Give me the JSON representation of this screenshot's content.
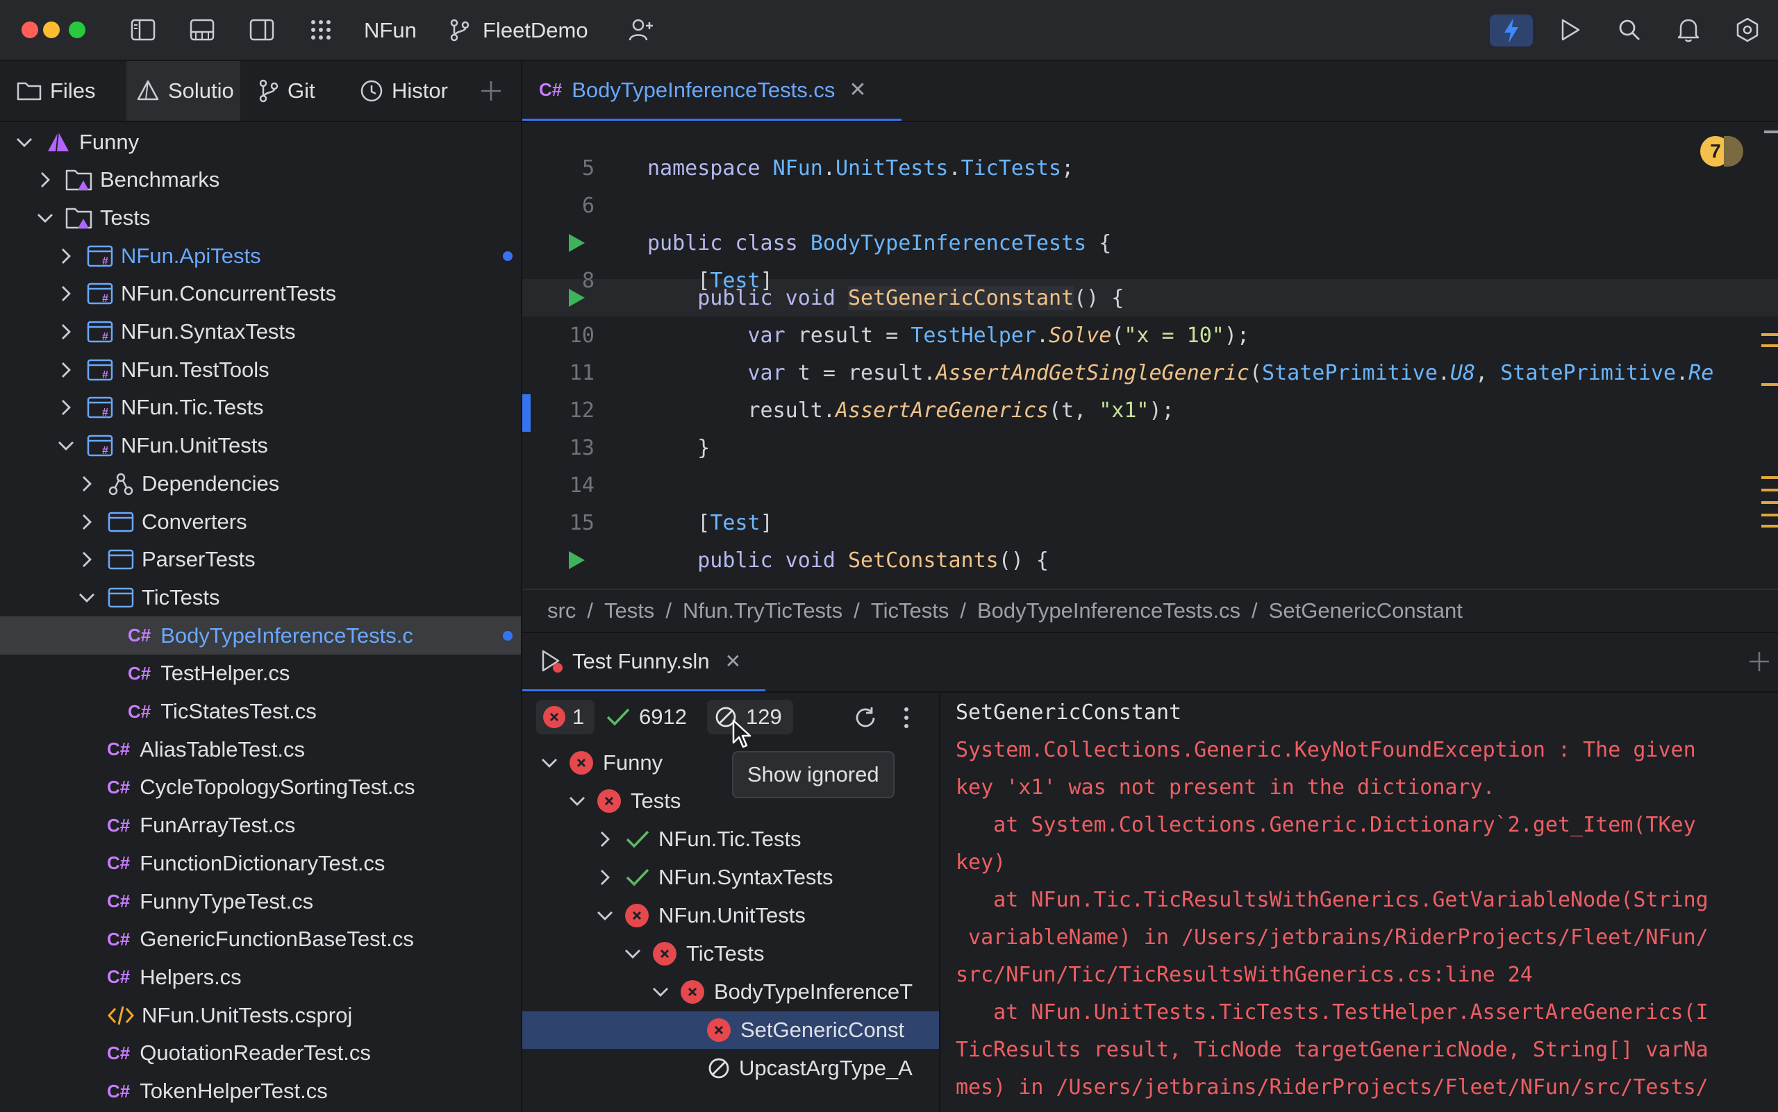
{
  "titlebar": {
    "app_name": "NFun",
    "workspace": "FleetDemo"
  },
  "left_tabs": [
    "Files",
    "Solutio",
    "Git",
    "Histor"
  ],
  "tree": [
    {
      "label": "Funny",
      "level": 0,
      "chevron": "down",
      "icon": "solution-icon",
      "style": "normal"
    },
    {
      "label": "Benchmarks",
      "level": 1,
      "chevron": "right",
      "icon": "folder-icon",
      "style": "normal"
    },
    {
      "label": "Tests",
      "level": 1,
      "chevron": "down",
      "icon": "folder-icon",
      "style": "normal"
    },
    {
      "label": "NFun.ApiTests",
      "level": 2,
      "chevron": "right",
      "icon": "csproj-icon",
      "style": "modified"
    },
    {
      "label": "NFun.ConcurrentTests",
      "level": 2,
      "chevron": "right",
      "icon": "csproj-icon",
      "style": "normal"
    },
    {
      "label": "NFun.SyntaxTests",
      "level": 2,
      "chevron": "right",
      "icon": "csproj-icon",
      "style": "normal"
    },
    {
      "label": "NFun.TestTools",
      "level": 2,
      "chevron": "right",
      "icon": "csproj-icon",
      "style": "normal"
    },
    {
      "label": "NFun.Tic.Tests",
      "level": 2,
      "chevron": "right",
      "icon": "csproj-icon",
      "style": "normal"
    },
    {
      "label": "NFun.UnitTests",
      "level": 2,
      "chevron": "down",
      "icon": "csproj-icon",
      "style": "normal"
    },
    {
      "label": "Dependencies",
      "level": 3,
      "chevron": "right",
      "icon": "dependencies-icon",
      "style": "normal"
    },
    {
      "label": "Converters",
      "level": 3,
      "chevron": "right",
      "icon": "namespace-folder-icon",
      "style": "normal"
    },
    {
      "label": "ParserTests",
      "level": 3,
      "chevron": "right",
      "icon": "namespace-folder-icon",
      "style": "normal"
    },
    {
      "label": "TicTests",
      "level": 3,
      "chevron": "down",
      "icon": "namespace-folder-icon",
      "style": "normal"
    },
    {
      "label": "BodyTypeInferenceTests.c",
      "level": 4,
      "chevron": "none",
      "icon": "csharp-file-icon",
      "style": "selected"
    },
    {
      "label": "TestHelper.cs",
      "level": 4,
      "chevron": "none",
      "icon": "csharp-file-icon",
      "style": "normal"
    },
    {
      "label": "TicStatesTest.cs",
      "level": 4,
      "chevron": "none",
      "icon": "csharp-file-icon",
      "style": "normal"
    },
    {
      "label": "AliasTableTest.cs",
      "level": 3,
      "chevron": "none",
      "icon": "csharp-file-icon",
      "style": "normal"
    },
    {
      "label": "CycleTopologySortingTest.cs",
      "level": 3,
      "chevron": "none",
      "icon": "csharp-file-icon",
      "style": "normal"
    },
    {
      "label": "FunArrayTest.cs",
      "level": 3,
      "chevron": "none",
      "icon": "csharp-file-icon",
      "style": "normal"
    },
    {
      "label": "FunctionDictionaryTest.cs",
      "level": 3,
      "chevron": "none",
      "icon": "csharp-file-icon",
      "style": "normal"
    },
    {
      "label": "FunnyTypeTest.cs",
      "level": 3,
      "chevron": "none",
      "icon": "csharp-file-icon",
      "style": "normal"
    },
    {
      "label": "GenericFunctionBaseTest.cs",
      "level": 3,
      "chevron": "none",
      "icon": "csharp-file-icon",
      "style": "normal"
    },
    {
      "label": "Helpers.cs",
      "level": 3,
      "chevron": "none",
      "icon": "csharp-file-icon",
      "style": "normal"
    },
    {
      "label": "NFun.UnitTests.csproj",
      "level": 3,
      "chevron": "none",
      "icon": "xml-file-icon",
      "style": "normal"
    },
    {
      "label": "QuotationReaderTest.cs",
      "level": 3,
      "chevron": "none",
      "icon": "csharp-file-icon",
      "style": "normal"
    },
    {
      "label": "TokenHelperTest.cs",
      "level": 3,
      "chevron": "none",
      "icon": "csharp-file-icon",
      "style": "normal"
    }
  ],
  "editor": {
    "tab_prefix": "C#",
    "tab_label": "BodyTypeInferenceTests.cs",
    "inspection_count": "7",
    "line_numbers": [
      "5",
      "6",
      "",
      "8",
      "",
      "10",
      "11",
      "12",
      "13",
      "14",
      "15",
      ""
    ],
    "code": {
      "l5_kw": "namespace ",
      "l5_ns1": "NFun",
      "l5_dot1": ".",
      "l5_ns2": "UnitTests",
      "l5_dot2": ".",
      "l5_ns3": "TicTests",
      "l5_end": ";",
      "l7_kw": "public class ",
      "l7_name": "BodyTypeInferenceTests",
      "l7_end": " {",
      "l8_open": "    [",
      "l8_attr": "Test",
      "l8_close": "]",
      "l9_kw": "    public void ",
      "l9_name": "SetGenericConstant",
      "l9_end": "() {",
      "l10_kw": "        var ",
      "l10_a": "result = ",
      "l10_ty": "TestHelper",
      "l10_dot": ".",
      "l10_fn": "Solve",
      "l10_p1": "(",
      "l10_str": "\"x = 10\"",
      "l10_p2": ");",
      "l11_kw": "        var ",
      "l11_a": "t = result.",
      "l11_fn": "AssertAndGetSingleGeneric",
      "l11_p1": "(",
      "l11_ty1": "StatePrimitive",
      "l11_dot1": ".",
      "l11_c1": "U8",
      "l11_comma": ", ",
      "l11_ty2": "StatePrimitive",
      "l11_dot2": ".",
      "l11_c2": "Re",
      "l12_a": "        result.",
      "l12_fn": "AssertAreGenerics",
      "l12_p1": "(t, ",
      "l12_str": "\"x1\"",
      "l12_p2": ");",
      "l13": "    }",
      "l15_open": "    [",
      "l15_attr": "Test",
      "l15_close": "]",
      "l16_kw": "    public void ",
      "l16_name": "SetConstants",
      "l16_end": "() {"
    }
  },
  "breadcrumb": [
    "src",
    "Tests",
    "Nfun.TryTicTests",
    "TicTests",
    "BodyTypeInferenceTests.cs",
    "SetGenericConstant"
  ],
  "test_panel": {
    "tab_label": "Test Funny.sln",
    "failed_count": "1",
    "passed_count": "6912",
    "ignored_count": "129",
    "tooltip": "Show ignored",
    "tree": [
      {
        "label": "Funny",
        "status": "failed",
        "chevron": "down",
        "level": 0
      },
      {
        "label": "Tests",
        "status": "failed",
        "chevron": "down",
        "level": 1
      },
      {
        "label": "NFun.Tic.Tests",
        "status": "passed",
        "chevron": "right",
        "level": 2
      },
      {
        "label": "NFun.SyntaxTests",
        "status": "passed",
        "chevron": "right",
        "level": 2
      },
      {
        "label": "NFun.UnitTests",
        "status": "failed",
        "chevron": "down",
        "level": 2
      },
      {
        "label": "TicTests",
        "status": "failed",
        "chevron": "down",
        "level": 3
      },
      {
        "label": "BodyTypeInferenceT",
        "status": "failed",
        "chevron": "down",
        "level": 4
      },
      {
        "label": "SetGenericConst",
        "status": "failed",
        "chevron": "none",
        "level": 5
      },
      {
        "label": "UpcastArgType_A",
        "status": "ignored",
        "chevron": "none",
        "level": 5
      }
    ],
    "output_title": "SetGenericConstant",
    "output_lines": [
      "System.Collections.Generic.KeyNotFoundException : The given",
      "key 'x1' was not present in the dictionary.",
      "   at System.Collections.Generic.Dictionary`2.get_Item(TKey",
      "key)",
      "   at NFun.Tic.TicResultsWithGenerics.GetVariableNode(String",
      " variableName) in /Users/jetbrains/RiderProjects/Fleet/NFun/",
      "src/NFun/Tic/TicResultsWithGenerics.cs:line 24",
      "   at NFun.UnitTests.TicTests.TestHelper.AssertAreGenerics(I",
      "TicResults result, TicNode targetGenericNode, String[] varNa",
      "mes) in /Users/jetbrains/RiderProjects/Fleet/NFun/src/Tests/"
    ]
  },
  "colors": {
    "accent": "#3574f0",
    "error": "#e5484d",
    "success": "#5fb865",
    "csharp_icon": "#c77dff",
    "selection": "#2e436e"
  }
}
